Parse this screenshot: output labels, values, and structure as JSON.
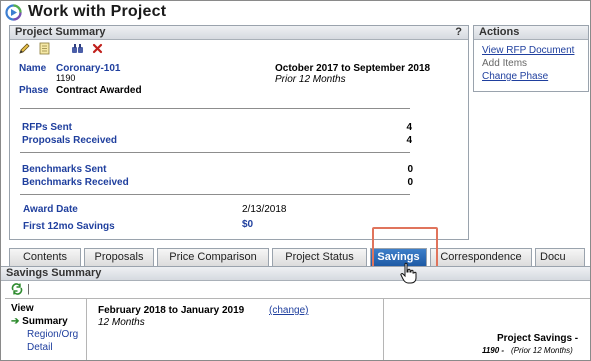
{
  "window": {
    "title": "Work with Project"
  },
  "project_summary": {
    "header": "Project Summary",
    "help": "?",
    "name_label": "Name",
    "name_value": "Coronary-101",
    "name_id": "1190",
    "phase_label": "Phase",
    "phase_value": "Contract Awarded",
    "period": "October 2017 to September 2018",
    "period_sub": "Prior 12 Months",
    "rfps_sent_label": "RFPs Sent",
    "rfps_sent_value": "4",
    "proposals_received_label": "Proposals Received",
    "proposals_received_value": "4",
    "benchmarks_sent_label": "Benchmarks Sent",
    "benchmarks_sent_value": "0",
    "benchmarks_received_label": "Benchmarks Received",
    "benchmarks_received_value": "0",
    "award_date_label": "Award Date",
    "award_date_value": "2/13/2018",
    "first_savings_label": "First 12mo Savings",
    "first_savings_value": "$0"
  },
  "toolbar": {
    "icons": [
      "pencil-icon",
      "notes-icon",
      "binoculars-icon",
      "delete-icon"
    ]
  },
  "actions": {
    "header": "Actions",
    "view_rfp": "View RFP Document",
    "add_items": "Add Items",
    "change_phase": "Change Phase"
  },
  "tabs": [
    {
      "label": "Contents"
    },
    {
      "label": "Proposals"
    },
    {
      "label": "Price Comparison"
    },
    {
      "label": "Project Status"
    },
    {
      "label": "Savings"
    },
    {
      "label": "Correspondence"
    },
    {
      "label": "Docu"
    }
  ],
  "savings_summary": {
    "header": "Savings Summary",
    "refresh_sep": "|",
    "view_title": "View",
    "view_summary": "Summary",
    "view_region": "Region/Org",
    "view_detail": "Detail",
    "period": "February 2018 to January 2019",
    "change_link": "(change)",
    "period_sub": "12 Months",
    "project_savings_title": "Project Savings -",
    "project_savings_sub_id": "1190 -",
    "project_savings_sub": "(Prior 12 Months)"
  },
  "colors": {
    "link": "#1f3f9e",
    "active_tab": "#2a6bb8",
    "highlight": "#e0745c"
  }
}
